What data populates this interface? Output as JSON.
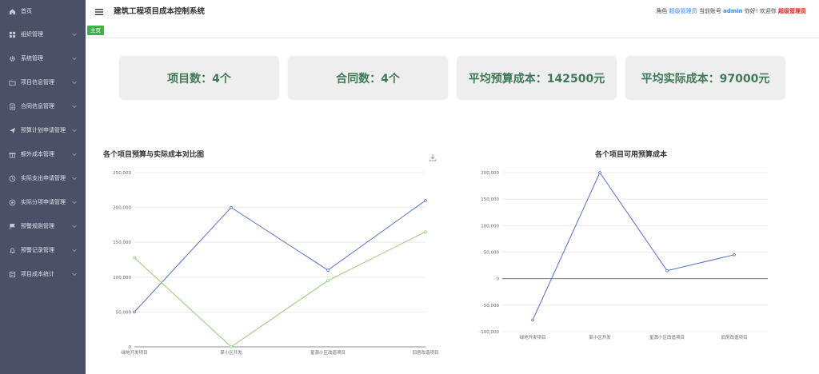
{
  "sidebar": {
    "items": [
      {
        "label": "首页",
        "icon": "home-icon",
        "has_submenu": false
      },
      {
        "label": "组织管理",
        "icon": "grid-icon",
        "has_submenu": true
      },
      {
        "label": "系统管理",
        "icon": "gear-icon",
        "has_submenu": true
      },
      {
        "label": "项目信息管理",
        "icon": "folder-icon",
        "has_submenu": true
      },
      {
        "label": "合同信息管理",
        "icon": "document-icon",
        "has_submenu": true
      },
      {
        "label": "预算计划申请管理",
        "icon": "send-icon",
        "has_submenu": true
      },
      {
        "label": "额外成本管理",
        "icon": "gift-icon",
        "has_submenu": true
      },
      {
        "label": "实际支出申请管理",
        "icon": "clock-icon",
        "has_submenu": true
      },
      {
        "label": "实际分项申请管理",
        "icon": "settings-circle-icon",
        "has_submenu": true
      },
      {
        "label": "预警规则管理",
        "icon": "flag-icon",
        "has_submenu": true
      },
      {
        "label": "预警记录管理",
        "icon": "bell-icon",
        "has_submenu": true
      },
      {
        "label": "项目成本统计",
        "icon": "report-icon",
        "has_submenu": true
      }
    ]
  },
  "header": {
    "title": "建筑工程项目成本控制系统",
    "role_prefix": "角色",
    "role": "超级管理员",
    "account_prefix": "当前账号",
    "account": "admin",
    "greeting": "你好! 欢迎你",
    "welcome_name": "超级管理员"
  },
  "tabs": [
    {
      "label": "主页"
    }
  ],
  "stats": [
    {
      "label": "项目数：4个"
    },
    {
      "label": "合同数：4个"
    },
    {
      "label": "平均预算成本：142500元"
    },
    {
      "label": "平均实际成本：97000元"
    }
  ],
  "colors": {
    "sidebar_bg": "#4a5066",
    "budget_line": "#5470c6",
    "actual_line": "#91cc75",
    "stat_text": "#3e7a59"
  },
  "chart_data": [
    {
      "type": "line",
      "title": "各个项目预算与实际成本对比图",
      "categories": [
        "绿地开发项目",
        "某小区开发",
        "星源小区改造项目",
        "旧房改造项目"
      ],
      "series": [
        {
          "values": [
            50000,
            200000,
            110000,
            210000
          ]
        },
        {
          "values": [
            128000,
            0,
            95000,
            165000
          ]
        }
      ],
      "y_ticks": [
        "0",
        "50,000",
        "100,000",
        "150,000",
        "200,000",
        "250,000"
      ],
      "ylim": [
        0,
        250000
      ],
      "grid": true
    },
    {
      "type": "line",
      "title": "各个项目可用预算成本",
      "categories": [
        "绿地开发项目",
        "某小区开发",
        "星源小区改造项目",
        "旧房改造项目"
      ],
      "series": [
        {
          "values": [
            -78000,
            200000,
            15000,
            45000
          ]
        }
      ],
      "y_ticks": [
        "-100,000",
        "-50,000",
        "0",
        "50,000",
        "100,000",
        "150,000",
        "200,000"
      ],
      "ylim": [
        -100000,
        200000
      ],
      "grid": true
    }
  ]
}
